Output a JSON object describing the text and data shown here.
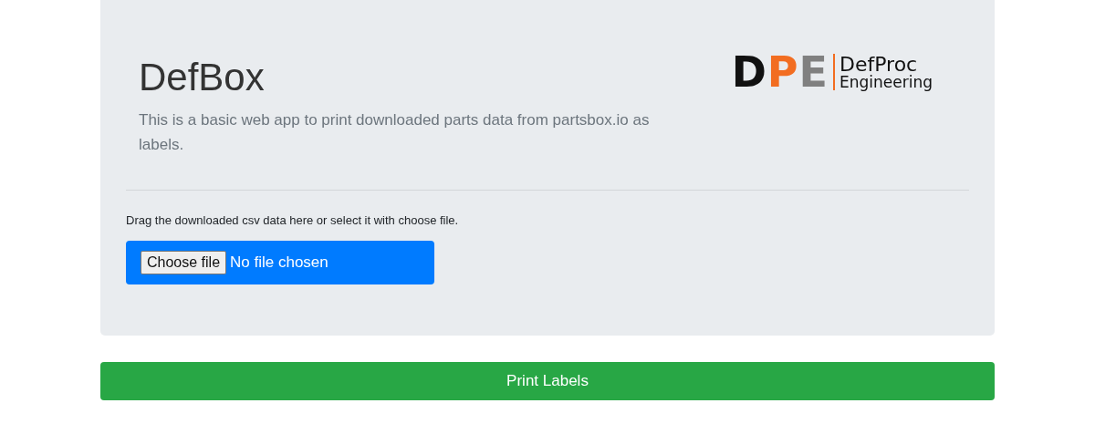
{
  "header": {
    "title": "DefBox",
    "description": "This is a basic web app to print downloaded parts data from partsbox.io as labels.",
    "logo": {
      "initials": [
        {
          "text": "D",
          "color": "#111111"
        },
        {
          "text": "P",
          "color": "#f26d21"
        },
        {
          "text": "E",
          "color": "#808080"
        }
      ],
      "name": "DefProc",
      "subtitle": "Engineering"
    }
  },
  "upload": {
    "label": "Drag the downloaded csv data here or select it with choose file.",
    "button": "Choose file",
    "status": "No file chosen"
  },
  "print_button": "Print Labels"
}
